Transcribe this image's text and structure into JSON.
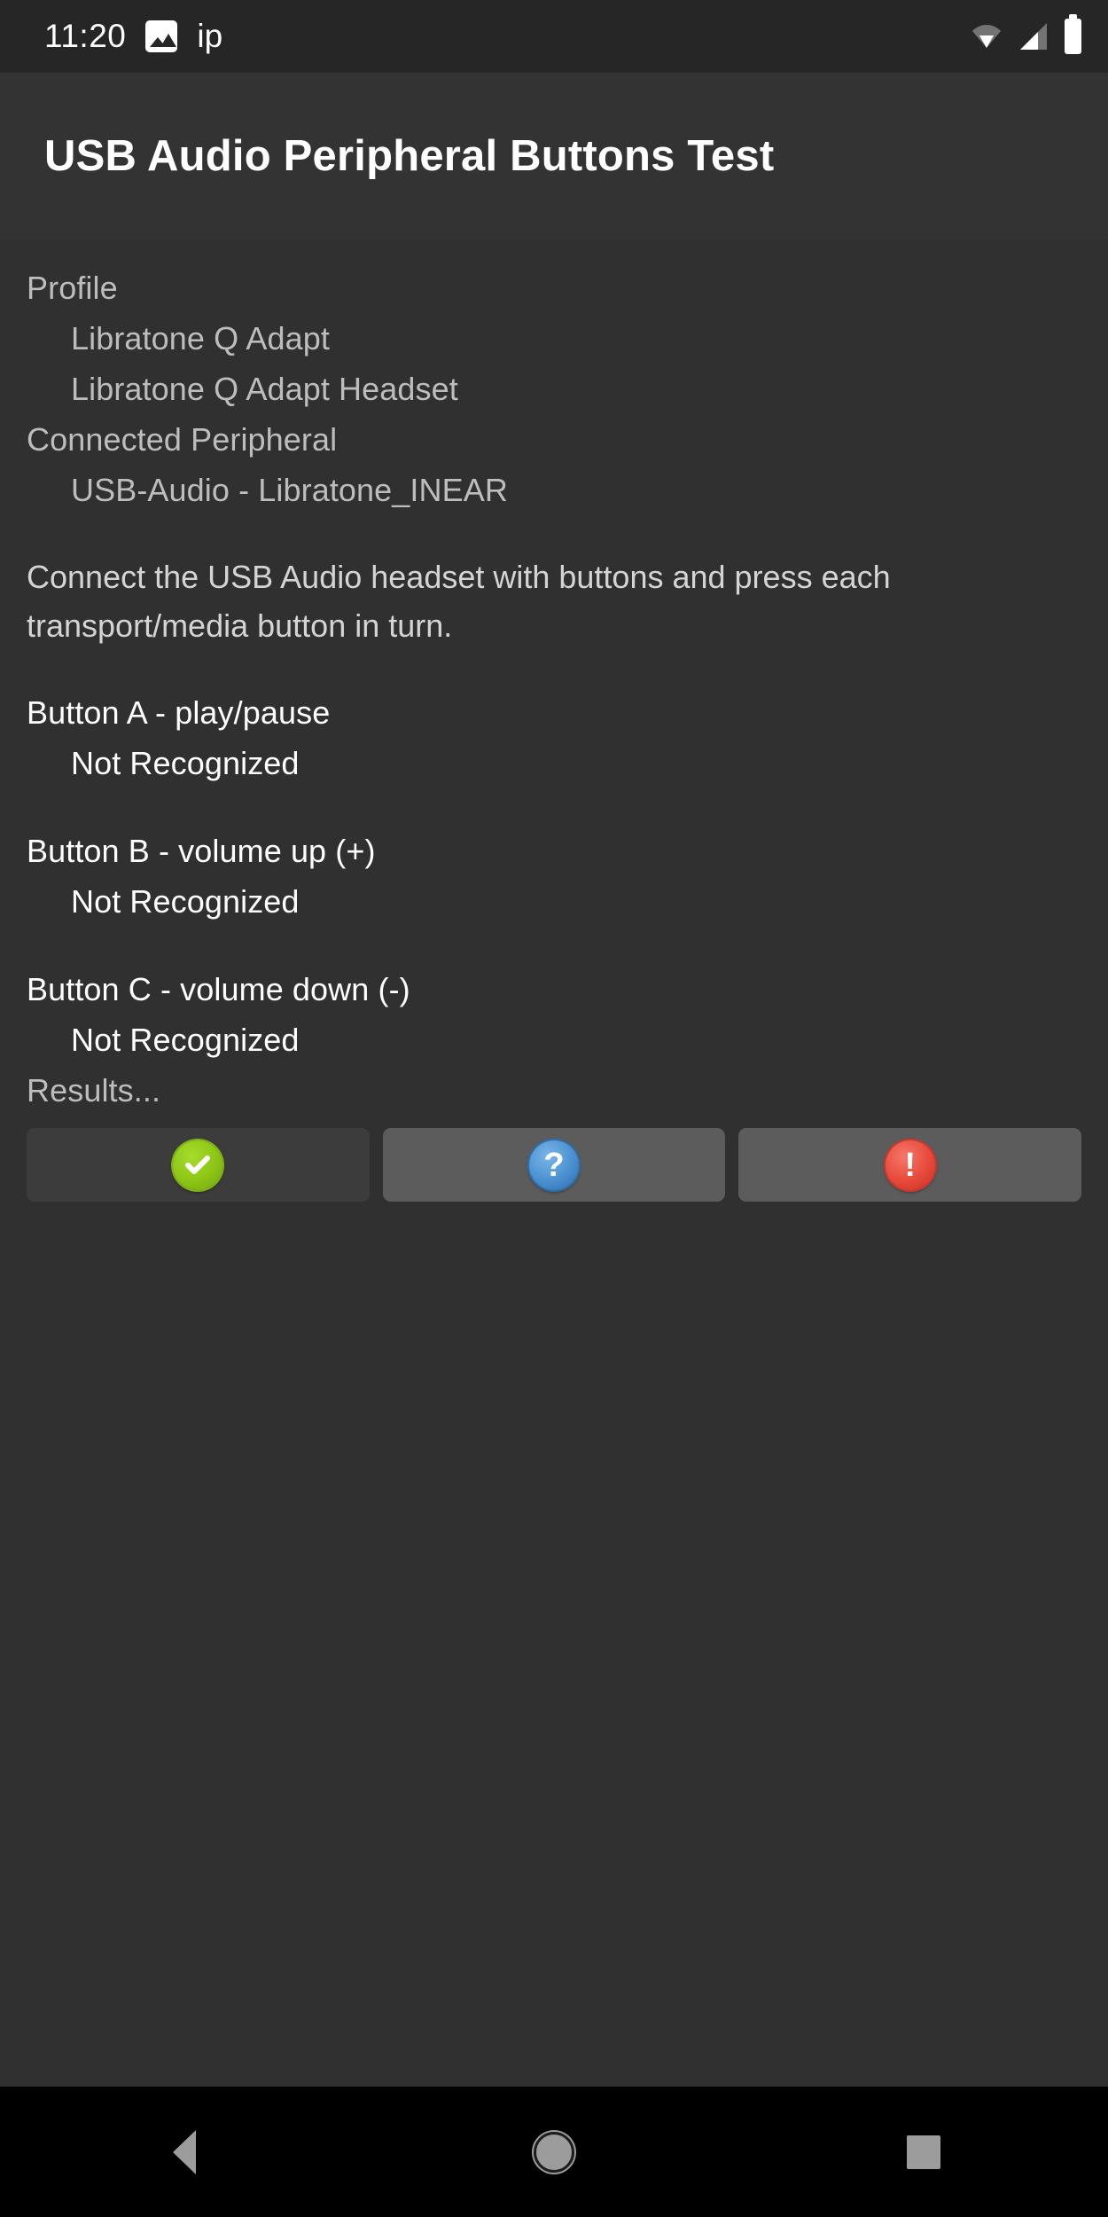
{
  "status_bar": {
    "time": "11:20",
    "notification_icon": "image-icon",
    "notification_text": "ip",
    "right_icons": [
      "wifi-icon",
      "cellular-signal-icon",
      "battery-icon"
    ]
  },
  "app": {
    "title": "USB Audio Peripheral Buttons Test"
  },
  "info": {
    "profile_label": "Profile",
    "profile_values": [
      "Libratone Q Adapt",
      "Libratone Q Adapt Headset"
    ],
    "peripheral_label": "Connected Peripheral",
    "peripheral_values": [
      "USB-Audio - Libratone_INEAR"
    ]
  },
  "instructions": "Connect the USB Audio headset with buttons and press each transport/media button in turn.",
  "buttons_tests": [
    {
      "label": "Button A - play/pause",
      "status": "Not Recognized"
    },
    {
      "label": "Button B - volume up (+)",
      "status": "Not Recognized"
    },
    {
      "label": "Button C - volume down (-)",
      "status": "Not Recognized"
    }
  ],
  "results": {
    "label": "Results...",
    "actions": [
      {
        "name": "pass-button",
        "icon": "check-circle-icon",
        "enabled": false,
        "color": "#8cc516"
      },
      {
        "name": "info-button",
        "icon": "question-circle-icon",
        "enabled": true,
        "color": "#4a90d0"
      },
      {
        "name": "fail-button",
        "icon": "exclamation-circle-icon",
        "enabled": true,
        "color": "#e8493a"
      }
    ]
  },
  "navigation": {
    "back": "back-button",
    "home": "home-button",
    "recents": "recents-button"
  },
  "theme": {
    "background": "#303030",
    "status_bar_bg": "#262626",
    "title_bar_bg": "#333333",
    "nav_bar_bg": "#000000",
    "dim_text": "#bdbdbd",
    "bright_text": "#ffffff"
  }
}
